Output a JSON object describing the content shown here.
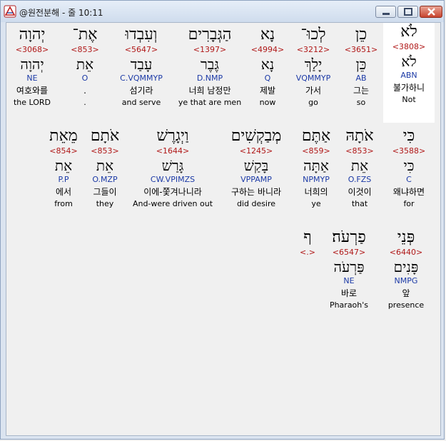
{
  "window": {
    "title": "@원전분해 - 줄 10:11"
  },
  "rows": [
    {
      "words": [
        {
          "heb": "לֹא",
          "strong": "<3808>",
          "lemma": "לֹא",
          "parse": "ABN",
          "kor": "불가하니",
          "eng": "Not",
          "selected": true
        },
        {
          "heb": "כֵן",
          "strong": "<3651>",
          "lemma": "כֵּן",
          "parse": "AB",
          "kor": "그는",
          "eng": "so"
        },
        {
          "heb": "לְכוּ־",
          "strong": "<3212>",
          "lemma": "יָלַךְ",
          "parse": "VQMMYP",
          "kor": "가서",
          "eng": "go"
        },
        {
          "heb": "נָא",
          "strong": "<4994>",
          "lemma": "נָא",
          "parse": "Q",
          "kor": "제발",
          "eng": "now"
        },
        {
          "heb": "הַגְּבָרִים",
          "strong": "<1397>",
          "lemma": "גֶּבֶר",
          "parse": "D.NMP",
          "kor": "너희 남정만",
          "eng": "ye that are men"
        },
        {
          "heb": "וְעִבְדוּ",
          "strong": "<5647>",
          "lemma": "עָבַד",
          "parse": "C.VQMMYP",
          "kor": "섬기라",
          "eng": "and serve"
        },
        {
          "heb": "אֶת־",
          "strong": "<853>",
          "lemma": "אֵת",
          "parse": "O",
          "kor": ".",
          "eng": "."
        },
        {
          "heb": "יְהוָה",
          "strong": "<3068>",
          "lemma": "יְהוָה",
          "parse": "NE",
          "kor": "여호와를",
          "eng": "the LORD"
        }
      ]
    },
    {
      "words": [
        {
          "heb": "כִּי",
          "strong": "<3588>",
          "lemma": "כִּי",
          "parse": "C",
          "kor": "왜냐하면",
          "eng": "for"
        },
        {
          "heb": "אֹתָהּ",
          "strong": "<853>",
          "lemma": "אֵת",
          "parse": "O.FZS",
          "kor": "이것이",
          "eng": "that"
        },
        {
          "heb": "אַתֶּם",
          "strong": "<859>",
          "lemma": "אַתָּה",
          "parse": "NPMYP",
          "kor": "너희의",
          "eng": "ye"
        },
        {
          "heb": "מְבַקְשִׁים",
          "strong": "<1245>",
          "lemma": "בָּקַשׁ",
          "parse": "VPPAMP",
          "kor": "구하는 바니라",
          "eng": "did desire"
        },
        {
          "heb": "וַיְגָרֶשׁ",
          "strong": "<1644>",
          "lemma": "גָּרַשׁ",
          "parse": "CW.VPIMZS",
          "kor": "이에-쫓겨나니라",
          "eng": "And-were driven out"
        },
        {
          "heb": "אֹתָם",
          "strong": "<853>",
          "lemma": "אֵת",
          "parse": "O.MZP",
          "kor": "그들이",
          "eng": "they"
        },
        {
          "heb": "מֵאֵת",
          "strong": "<854>",
          "lemma": "אֵת",
          "parse": "P.P",
          "kor": "에서",
          "eng": "from"
        }
      ]
    },
    {
      "words": [
        {
          "heb": "פְּנֵי",
          "strong": "<6440>",
          "lemma": "פָּנִים",
          "parse": "NMPG",
          "kor": "앞",
          "eng": "presence"
        },
        {
          "heb": "פַרְעֹה׃",
          "strong": "<6547>",
          "lemma": "פַּרְעֹה",
          "parse": "NE",
          "kor": "바로",
          "eng": "Pharaoh's"
        },
        {
          "heb": "ף",
          "strong": "<.>",
          "lemma": "",
          "parse": "",
          "kor": "",
          "eng": ""
        }
      ]
    }
  ]
}
